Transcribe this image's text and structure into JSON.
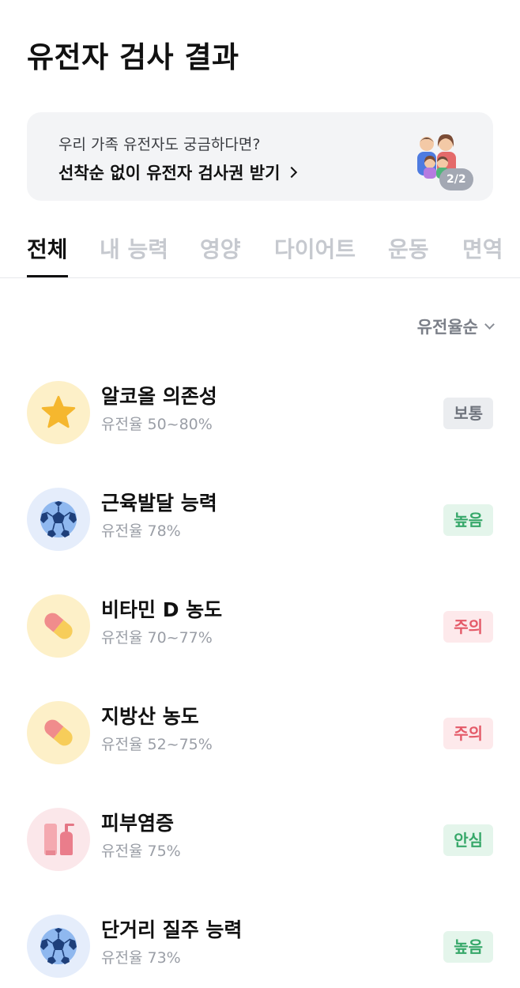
{
  "header": {
    "title": "유전자 검사 결과"
  },
  "promo": {
    "subtitle": "우리 가족 유전자도 궁금하다면?",
    "cta": "선착순 없이 유전자 검사권 받기",
    "page_indicator": "2/2",
    "icon": "family-icon"
  },
  "tabs": [
    {
      "label": "전체",
      "active": true
    },
    {
      "label": "내 능력",
      "active": false
    },
    {
      "label": "영양",
      "active": false
    },
    {
      "label": "다이어트",
      "active": false
    },
    {
      "label": "운동",
      "active": false
    },
    {
      "label": "면역",
      "active": false
    }
  ],
  "sort": {
    "label": "유전율순",
    "icon": "chevron-down-icon"
  },
  "items": [
    {
      "title": "알코올 의존성",
      "heritability": "유전율 50~80%",
      "status": "보통",
      "status_color": "#6f747d",
      "icon": "star-icon"
    },
    {
      "title": "근육발달 능력",
      "heritability": "유전율 78%",
      "status": "높음",
      "status_color": "#37a86a",
      "icon": "soccer-ball-icon"
    },
    {
      "title": "비타민 D 농도",
      "heritability": "유전율 70~77%",
      "status": "주의",
      "status_color": "#e45a68",
      "icon": "pill-capsule-icon"
    },
    {
      "title": "지방산 농도",
      "heritability": "유전율 52~75%",
      "status": "주의",
      "status_color": "#e45a68",
      "icon": "pill-capsule-icon"
    },
    {
      "title": "피부염증",
      "heritability": "유전율 75%",
      "status": "안심",
      "status_color": "#37a86a",
      "icon": "lotion-bottles-icon"
    },
    {
      "title": "단거리 질주 능력",
      "heritability": "유전율 73%",
      "status": "높음",
      "status_color": "#37a86a",
      "icon": "soccer-ball-icon"
    }
  ],
  "colors": {
    "accent": "#111111",
    "tab_inactive": "#c6c9cf",
    "promo_bg": "#f3f4f6"
  }
}
